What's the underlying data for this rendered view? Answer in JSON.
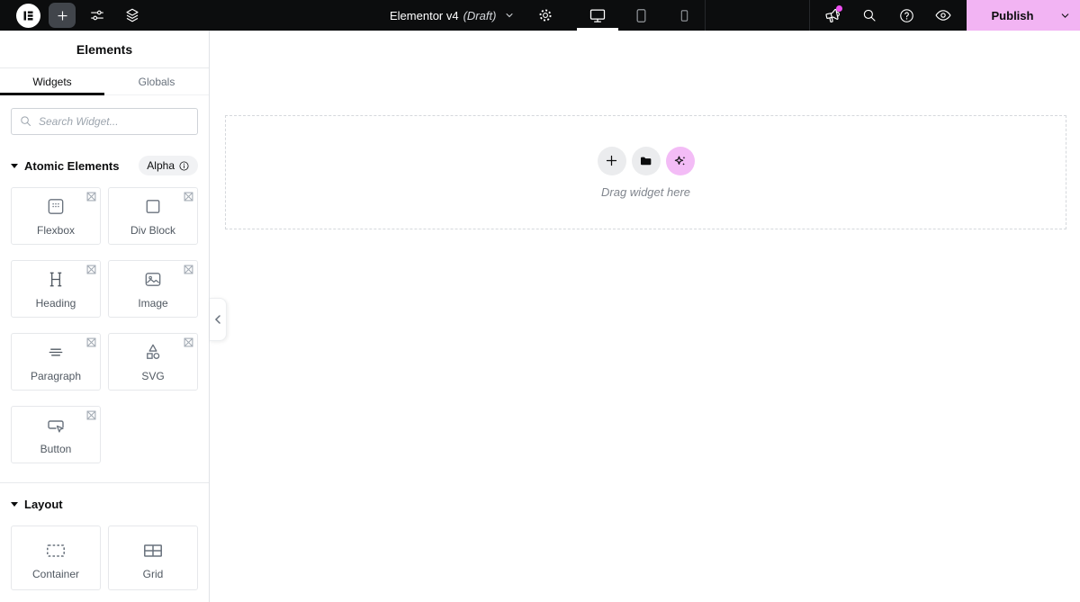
{
  "topbar": {
    "document_title": "Elementor v4",
    "document_status": "(Draft)",
    "publish_label": "Publish"
  },
  "sidebar": {
    "title": "Elements",
    "tabs": [
      {
        "label": "Widgets",
        "active": true
      },
      {
        "label": "Globals",
        "active": false
      }
    ],
    "search": {
      "placeholder": "Search Widget..."
    },
    "sections": [
      {
        "label": "Atomic Elements",
        "badge": "Alpha",
        "badge_icon": "info-icon",
        "widgets": [
          {
            "label": "Flexbox",
            "icon": "flexbox-icon",
            "corner_icon": "experiment-icon"
          },
          {
            "label": "Div Block",
            "icon": "div-block-icon",
            "corner_icon": "experiment-icon"
          },
          {
            "label": "Heading",
            "icon": "heading-icon",
            "corner_icon": "experiment-icon"
          },
          {
            "label": "Image",
            "icon": "image-icon",
            "corner_icon": "experiment-icon"
          },
          {
            "label": "Paragraph",
            "icon": "paragraph-icon",
            "corner_icon": "experiment-icon"
          },
          {
            "label": "SVG",
            "icon": "svg-shapes-icon",
            "corner_icon": "experiment-icon"
          },
          {
            "label": "Button",
            "icon": "button-icon",
            "corner_icon": "experiment-icon"
          }
        ]
      },
      {
        "label": "Layout",
        "widgets": [
          {
            "label": "Container",
            "icon": "container-icon"
          },
          {
            "label": "Grid",
            "icon": "grid-icon"
          }
        ]
      }
    ]
  },
  "canvas": {
    "drop_hint": "Drag widget here",
    "actions": [
      "add-element",
      "template-library",
      "ai-generate"
    ]
  },
  "colors": {
    "topbar_bg": "#0c0d0e",
    "accent_pink": "#f2b4f3",
    "notification_dot": "#ee4ff1",
    "dashed_border": "#d5d8dc",
    "active_tab_underline": "#0c0d0e"
  }
}
